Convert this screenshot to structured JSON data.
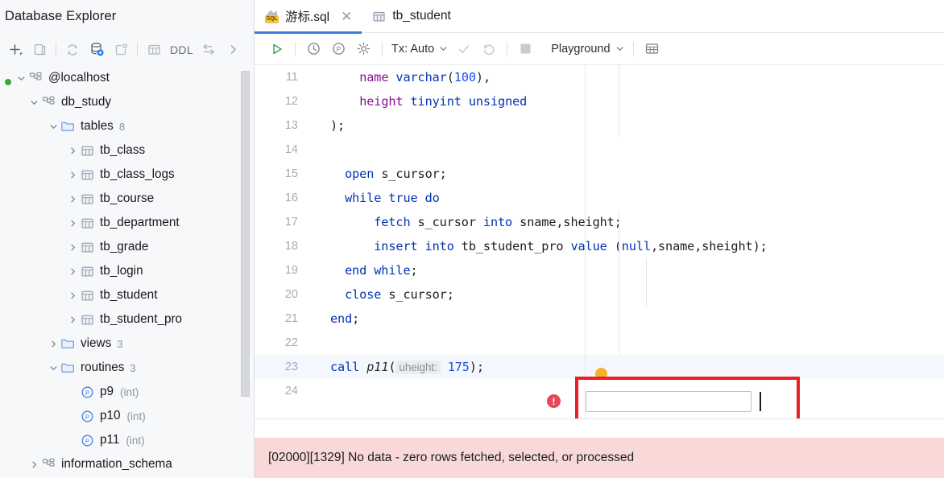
{
  "sidebar": {
    "title": "Database Explorer",
    "toolbar": [
      {
        "name": "add-icon",
        "label": "+"
      },
      {
        "name": "duplicate-icon",
        "label": ""
      },
      {
        "name": "refresh-icon",
        "label": ""
      },
      {
        "name": "database-settings-icon",
        "label": ""
      },
      {
        "name": "new-query-console-icon",
        "label": ""
      },
      {
        "name": "table-icon",
        "label": ""
      },
      {
        "name": "ddl-button",
        "label": "DDL"
      },
      {
        "name": "jump-to-icon",
        "label": ""
      },
      {
        "name": "expand-chevron-icon",
        "label": ""
      }
    ],
    "tree": [
      {
        "label": "@localhost",
        "icon": "connection-icon",
        "indent": 0,
        "twist": "expanded",
        "count": "",
        "type": "",
        "status": "connected"
      },
      {
        "label": "db_study",
        "icon": "schema-icon",
        "indent": 1,
        "twist": "expanded",
        "count": "",
        "type": ""
      },
      {
        "label": "tables",
        "icon": "folder-icon",
        "indent": 2,
        "twist": "expanded",
        "count": "8",
        "type": ""
      },
      {
        "label": "tb_class",
        "icon": "table-icon",
        "indent": 3,
        "twist": "collapsed",
        "count": "",
        "type": ""
      },
      {
        "label": "tb_class_logs",
        "icon": "table-icon",
        "indent": 3,
        "twist": "collapsed",
        "count": "",
        "type": ""
      },
      {
        "label": "tb_course",
        "icon": "table-icon",
        "indent": 3,
        "twist": "collapsed",
        "count": "",
        "type": ""
      },
      {
        "label": "tb_department",
        "icon": "table-icon",
        "indent": 3,
        "twist": "collapsed",
        "count": "",
        "type": ""
      },
      {
        "label": "tb_grade",
        "icon": "table-icon",
        "indent": 3,
        "twist": "collapsed",
        "count": "",
        "type": ""
      },
      {
        "label": "tb_login",
        "icon": "table-icon",
        "indent": 3,
        "twist": "collapsed",
        "count": "",
        "type": ""
      },
      {
        "label": "tb_student",
        "icon": "table-icon",
        "indent": 3,
        "twist": "collapsed",
        "count": "",
        "type": ""
      },
      {
        "label": "tb_student_pro",
        "icon": "table-icon",
        "indent": 3,
        "twist": "collapsed",
        "count": "",
        "type": ""
      },
      {
        "label": "views",
        "icon": "folder-icon",
        "indent": 2,
        "twist": "collapsed",
        "count": "3",
        "type": ""
      },
      {
        "label": "routines",
        "icon": "folder-icon",
        "indent": 2,
        "twist": "expanded",
        "count": "3",
        "type": ""
      },
      {
        "label": "p9",
        "icon": "procedure-icon",
        "indent": 3,
        "twist": "none",
        "count": "",
        "type": "(int)"
      },
      {
        "label": "p10",
        "icon": "procedure-icon",
        "indent": 3,
        "twist": "none",
        "count": "",
        "type": "(int)"
      },
      {
        "label": "p11",
        "icon": "procedure-icon",
        "indent": 3,
        "twist": "none",
        "count": "",
        "type": "(int)"
      },
      {
        "label": "information_schema",
        "icon": "schema-icon",
        "indent": 1,
        "twist": "collapsed",
        "count": "",
        "type": ""
      }
    ]
  },
  "tabs": [
    {
      "label": "游标.sql",
      "icon": "sql-file-icon",
      "active": true,
      "closable": true
    },
    {
      "label": "tb_student",
      "icon": "table-icon",
      "active": false,
      "closable": false
    }
  ],
  "editor_toolbar": {
    "run_label": "",
    "history_label": "",
    "procedure_label": "",
    "settings_label": "",
    "tx_label": "Tx: Auto",
    "commit_label": "",
    "rollback_label": "",
    "stop_label": "",
    "schema_label": "Playground",
    "grid_label": ""
  },
  "code": {
    "lines": [
      {
        "num": "11",
        "tokens": [
          {
            "t": "    ",
            "c": "plain"
          },
          {
            "t": "name",
            "c": "typ"
          },
          {
            "t": " ",
            "c": "plain"
          },
          {
            "t": "varchar",
            "c": "kw"
          },
          {
            "t": "(",
            "c": "plain"
          },
          {
            "t": "100",
            "c": "num"
          },
          {
            "t": "),",
            "c": "plain"
          }
        ]
      },
      {
        "num": "12",
        "tokens": [
          {
            "t": "    ",
            "c": "plain"
          },
          {
            "t": "height",
            "c": "typ"
          },
          {
            "t": " ",
            "c": "plain"
          },
          {
            "t": "tinyint unsigned",
            "c": "kw"
          }
        ]
      },
      {
        "num": "13",
        "tokens": [
          {
            "t": ");",
            "c": "plain"
          }
        ]
      },
      {
        "num": "14",
        "tokens": []
      },
      {
        "num": "15",
        "tokens": [
          {
            "t": "  ",
            "c": "plain"
          },
          {
            "t": "open",
            "c": "kw"
          },
          {
            "t": " s_cursor;",
            "c": "plain"
          }
        ]
      },
      {
        "num": "16",
        "tokens": [
          {
            "t": "  ",
            "c": "plain"
          },
          {
            "t": "while",
            "c": "kw"
          },
          {
            "t": " ",
            "c": "plain"
          },
          {
            "t": "true",
            "c": "kw"
          },
          {
            "t": " ",
            "c": "plain"
          },
          {
            "t": "do",
            "c": "kw"
          }
        ]
      },
      {
        "num": "17",
        "tokens": [
          {
            "t": "      ",
            "c": "plain"
          },
          {
            "t": "fetch",
            "c": "kw"
          },
          {
            "t": " s_cursor ",
            "c": "plain"
          },
          {
            "t": "into",
            "c": "kw"
          },
          {
            "t": " sname,sheight;",
            "c": "plain"
          }
        ]
      },
      {
        "num": "18",
        "tokens": [
          {
            "t": "      ",
            "c": "plain"
          },
          {
            "t": "insert into",
            "c": "kw"
          },
          {
            "t": " tb_student_pro ",
            "c": "plain"
          },
          {
            "t": "value",
            "c": "kw"
          },
          {
            "t": " (",
            "c": "plain"
          },
          {
            "t": "null",
            "c": "kw"
          },
          {
            "t": ",sname,sheight);",
            "c": "plain"
          }
        ]
      },
      {
        "num": "19",
        "tokens": [
          {
            "t": "  ",
            "c": "plain"
          },
          {
            "t": "end while",
            "c": "kw"
          },
          {
            "t": ";",
            "c": "plain"
          }
        ]
      },
      {
        "num": "20",
        "tokens": [
          {
            "t": "  ",
            "c": "plain"
          },
          {
            "t": "close",
            "c": "kw"
          },
          {
            "t": " s_cursor;",
            "c": "plain"
          }
        ]
      },
      {
        "num": "21",
        "tokens": [
          {
            "t": "end",
            "c": "kw"
          },
          {
            "t": ";",
            "c": "plain"
          }
        ]
      },
      {
        "num": "22",
        "tokens": []
      },
      {
        "num": "23",
        "tokens": [
          {
            "t": "call",
            "c": "kw"
          },
          {
            "t": " ",
            "c": "plain"
          },
          {
            "t": "p11",
            "c": "proc"
          },
          {
            "t": "(",
            "c": "plain"
          },
          {
            "t": "uheight:",
            "c": "inlay"
          },
          {
            "t": " ",
            "c": "plain"
          },
          {
            "t": "175",
            "c": "num"
          },
          {
            "t": ")",
            "c": "plain"
          },
          {
            "t": ";",
            "c": "plain"
          }
        ],
        "highlight": true,
        "error": true,
        "bulb": true
      },
      {
        "num": "24",
        "tokens": []
      }
    ]
  },
  "status": {
    "message": "[02000][1329] No data - zero rows fetched, selected, or processed"
  },
  "colors": {
    "accent": "#3b7ddd",
    "error_bg": "#f9d8d8",
    "error_icon": "#e3495a",
    "bulb": "#f3b12c",
    "annotation_box": "#ec2024",
    "keyword": "#0033b3",
    "type": "#871094",
    "number": "#1750eb",
    "connected_dot": "#37a83c"
  }
}
